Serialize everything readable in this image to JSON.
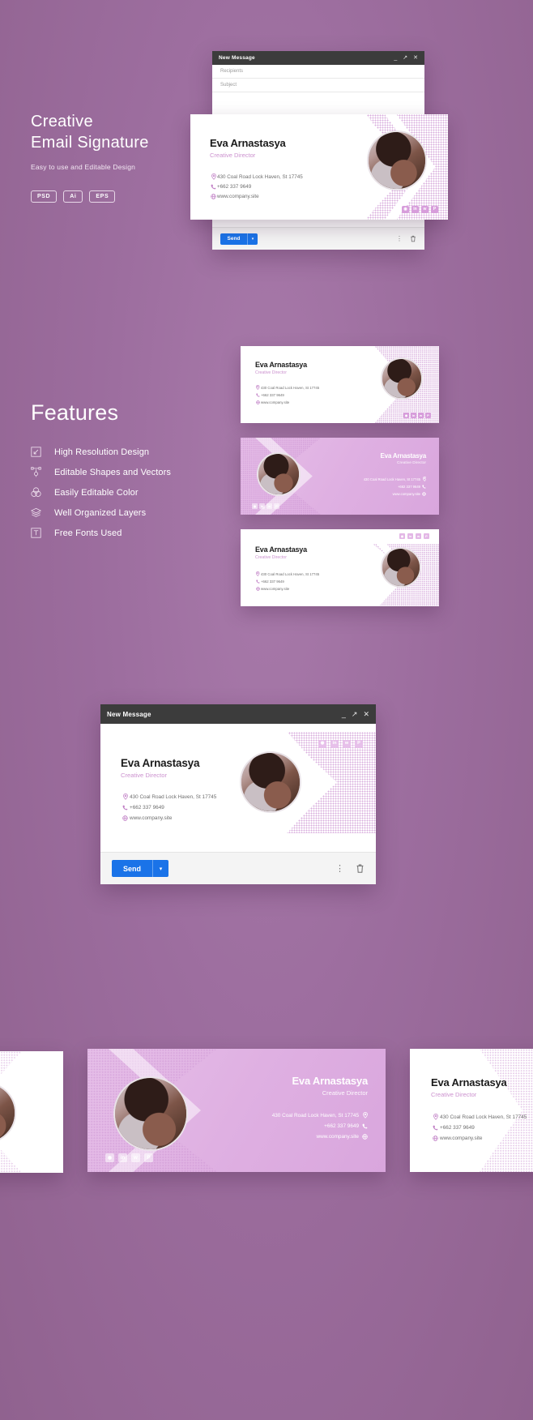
{
  "theme": {
    "background": "#9e6fa0",
    "accent_pink": "#cc92cf",
    "accent_dots": "#c98fd0",
    "send_blue": "#1a73e8",
    "titlebar": "#3c3c3c",
    "card_white": "#ffffff",
    "purple_card": "#dfb0e2"
  },
  "hero": {
    "line1": "Creative",
    "line2": "Email Signature",
    "subtitle": "Easy to use and Editable Design",
    "badges": [
      "PSD",
      "Ai",
      "EPS"
    ]
  },
  "features": {
    "title": "Features",
    "items": [
      {
        "label": "High Resolution Design",
        "icon": "resize-icon"
      },
      {
        "label": "Editable Shapes and Vectors",
        "icon": "vector-node-icon"
      },
      {
        "label": "Easily Editable Color",
        "icon": "color-circles-icon"
      },
      {
        "label": "Well Organized Layers",
        "icon": "layers-icon"
      },
      {
        "label": "Free Fonts Used",
        "icon": "text-type-icon"
      }
    ]
  },
  "mail_window_top": {
    "title": "New Message",
    "recipients_placeholder": "Recipients",
    "subject_placeholder": "Subject",
    "controls": [
      "minimize",
      "expand",
      "close"
    ],
    "send_label": "Send",
    "send_caret": "▾",
    "more_icon": "⋮",
    "trash_icon": "🗑"
  },
  "mail_window_bottom": {
    "title": "New Message",
    "controls": [
      "minimize",
      "expand",
      "close"
    ],
    "send_label": "Send",
    "send_caret": "▾",
    "more_icon": "⋮",
    "trash_icon": "🗑"
  },
  "signature": {
    "name": "Eva Arnastasya",
    "role": "Creative Director",
    "address": "430 Coal Road Lock Haven, St 17745",
    "phone": "+662 337 9649",
    "website": "www.company.site",
    "icons": {
      "address": "location-pin-icon",
      "phone": "phone-icon",
      "website": "globe-icon"
    },
    "social": [
      "instagram",
      "linkedin",
      "twitter",
      "pinterest"
    ]
  },
  "variants": [
    {
      "id": "variant-white-left-avatar-right",
      "style": "white"
    },
    {
      "id": "variant-purple-avatar-left",
      "style": "purple"
    },
    {
      "id": "variant-white-social-top",
      "style": "white"
    }
  ],
  "bottom_strip": [
    {
      "id": "strip-card-left-partial",
      "style": "white"
    },
    {
      "id": "strip-card-center-purple",
      "style": "purple"
    },
    {
      "id": "strip-card-right-partial",
      "style": "white"
    }
  ]
}
